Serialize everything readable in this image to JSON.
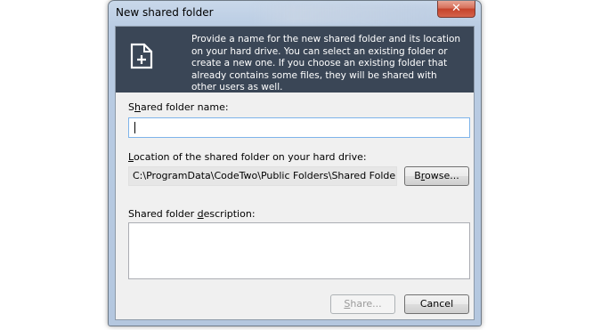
{
  "window": {
    "title": "New shared folder",
    "close_label": "✕"
  },
  "banner": {
    "text": "Provide a name for the new shared folder and its location on your hard drive. You can select an existing folder or create a new one. If you choose an existing folder that already contains some files, they will be shared with other users as well."
  },
  "form": {
    "name_label_prefix": "S",
    "name_label_underlined": "h",
    "name_label_rest": "ared folder name:",
    "name_value": "",
    "location_label_underlined": "L",
    "location_label_rest": "ocation of the shared folder on your hard drive:",
    "location_value": "C:\\ProgramData\\CodeTwo\\Public Folders\\Shared Folders",
    "browse_prefix": "B",
    "browse_underlined": "r",
    "browse_rest": "owse...",
    "description_label_prefix": "Shared folder ",
    "description_label_underlined": "d",
    "description_label_rest": "escription:",
    "description_value": ""
  },
  "buttons": {
    "share_underlined": "S",
    "share_rest": "hare...",
    "cancel_label": "Cancel"
  }
}
